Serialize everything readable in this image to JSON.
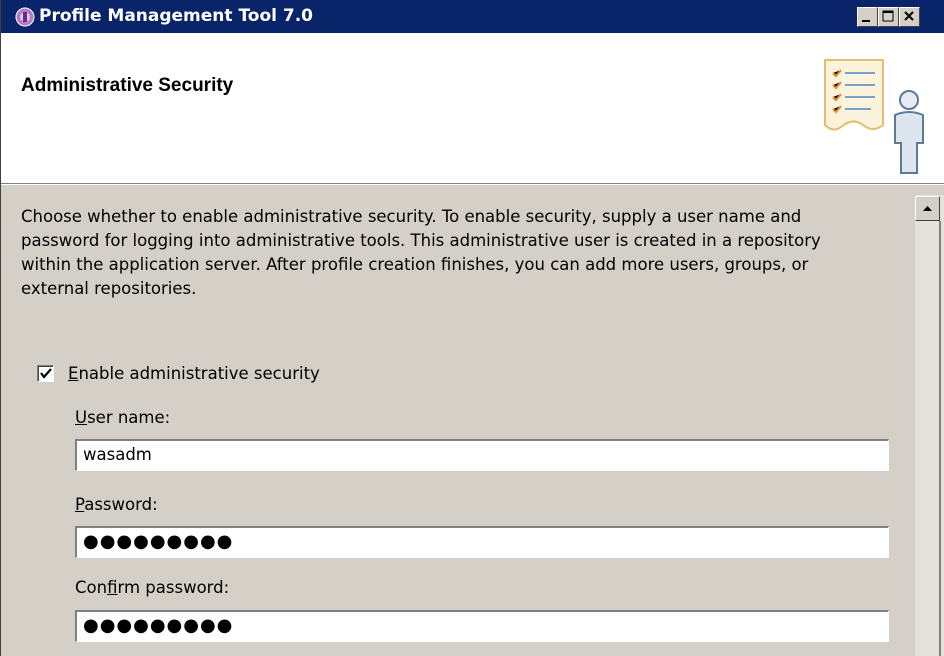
{
  "window": {
    "title": "Profile Management Tool 7.0",
    "icon": "app-icon",
    "controls": [
      "minimize-icon",
      "maximize-icon",
      "close-icon"
    ]
  },
  "banner": {
    "title": "Administrative Security",
    "graphic": "checklist-user-icon"
  },
  "description": "Choose whether to enable administrative security. To enable security, supply a user name and password for logging into administrative tools. This administrative user is created in a repository within the application server. After profile creation finishes, you can add more users, groups, or external repositories.",
  "security": {
    "enable_label_mnemonic": "E",
    "enable_label_rest": "nable administrative security",
    "enabled": true,
    "user_label_mnemonic": "U",
    "user_label_rest": "ser name:",
    "user_value": "wasadm",
    "password_label_mnemonic": "P",
    "password_label_rest": "assword:",
    "password_mask": "●●●●●●●●●",
    "confirm_label_pre": "Con",
    "confirm_label_mnemonic": "f",
    "confirm_label_rest": "irm password:",
    "confirm_mask": "●●●●●●●●●"
  },
  "colors": {
    "titlebar": "#0a246a",
    "dialog_bg": "#d4d0c8",
    "banner_bg": "#ffffff"
  }
}
